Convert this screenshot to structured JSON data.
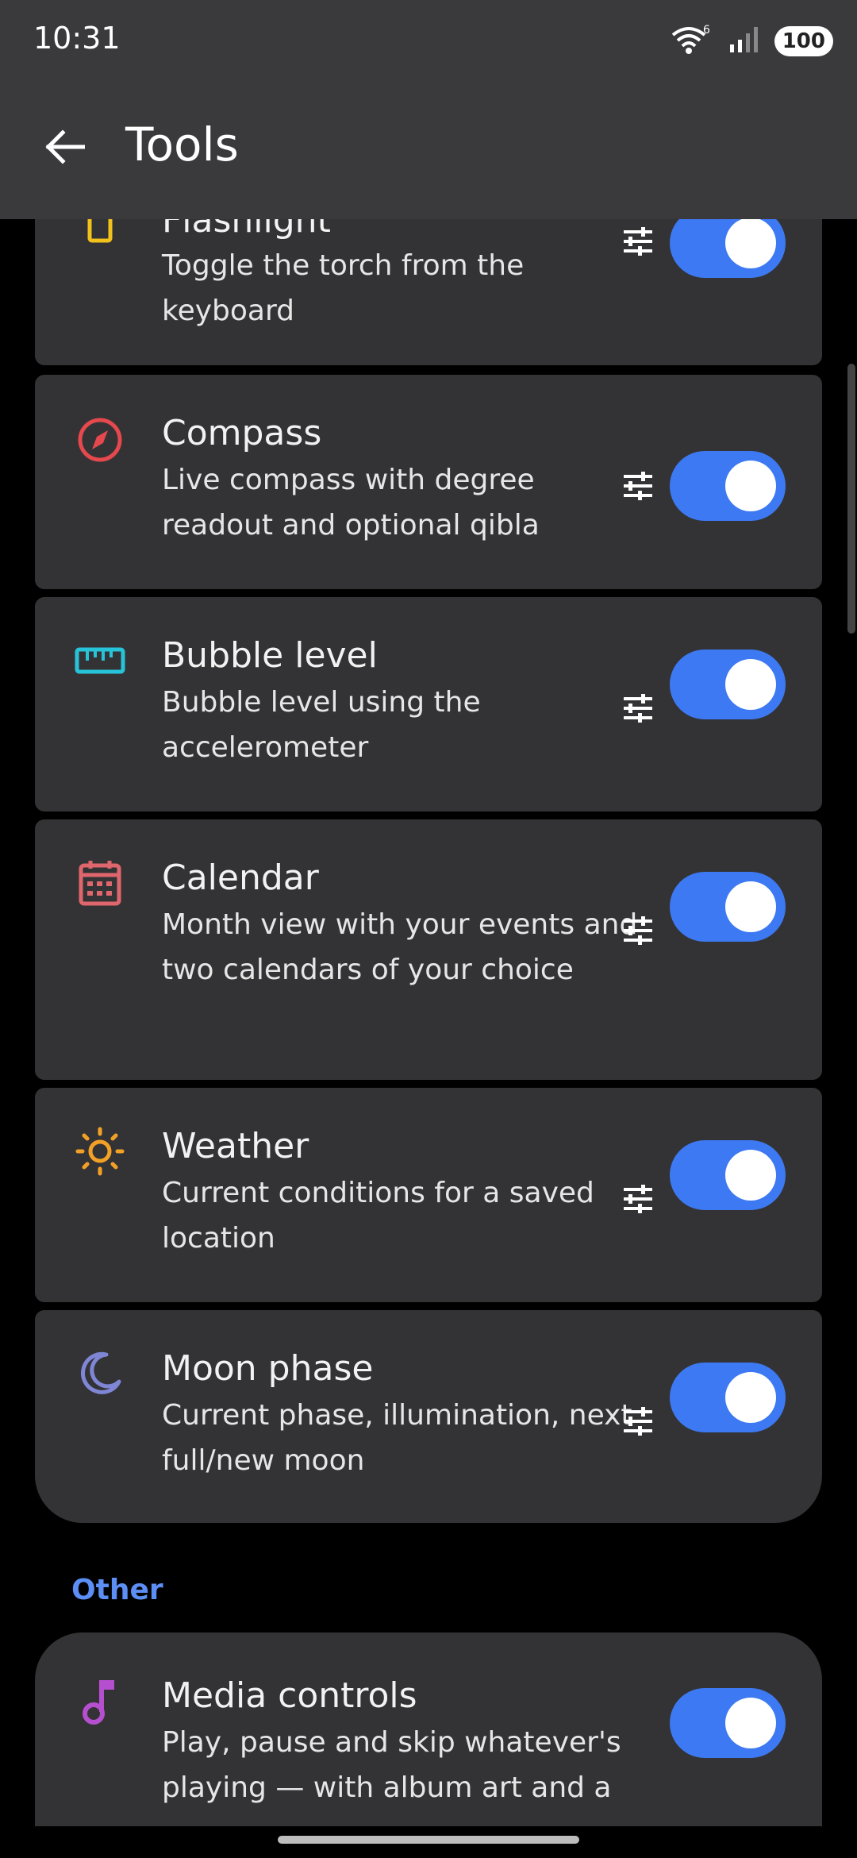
{
  "status": {
    "time": "10:31",
    "battery": "100",
    "wifi_badge": "6"
  },
  "header": {
    "title": "Tools"
  },
  "items": [
    {
      "title": "Flashlight",
      "desc": "Toggle the torch from the keyboard",
      "icon": "flashlight-icon",
      "icon_color": "#f2c21b",
      "enabled": true
    },
    {
      "title": "Compass",
      "desc": "Live compass with degree readout and optional qibla",
      "icon": "compass-icon",
      "icon_color": "#e5484d",
      "enabled": true
    },
    {
      "title": "Bubble level",
      "desc": "Bubble level using the accelerometer",
      "icon": "ruler-icon",
      "icon_color": "#27c3d8",
      "enabled": true
    },
    {
      "title": "Calendar",
      "desc": "Month view with your events and two calendars of your choice",
      "icon": "calendar-icon",
      "icon_color": "#e0666d",
      "enabled": true
    },
    {
      "title": "Weather",
      "desc": "Current conditions for a saved location",
      "icon": "sun-icon",
      "icon_color": "#f3a126",
      "enabled": true
    },
    {
      "title": "Moon phase",
      "desc": "Current phase, illumination, next full/new moon",
      "icon": "moon-icon",
      "icon_color": "#7f86d6",
      "enabled": true
    }
  ],
  "other_section": {
    "label": "Other",
    "items": [
      {
        "title": "Media controls",
        "desc": "Play, pause and skip whatever's playing — with album art and a",
        "icon": "music-note-icon",
        "icon_color": "#b64fcf",
        "enabled": true
      }
    ]
  },
  "colors": {
    "accent": "#3d79f2",
    "card": "#333335",
    "toolbar": "#3a3a3c",
    "section": "#5c8ff5"
  }
}
